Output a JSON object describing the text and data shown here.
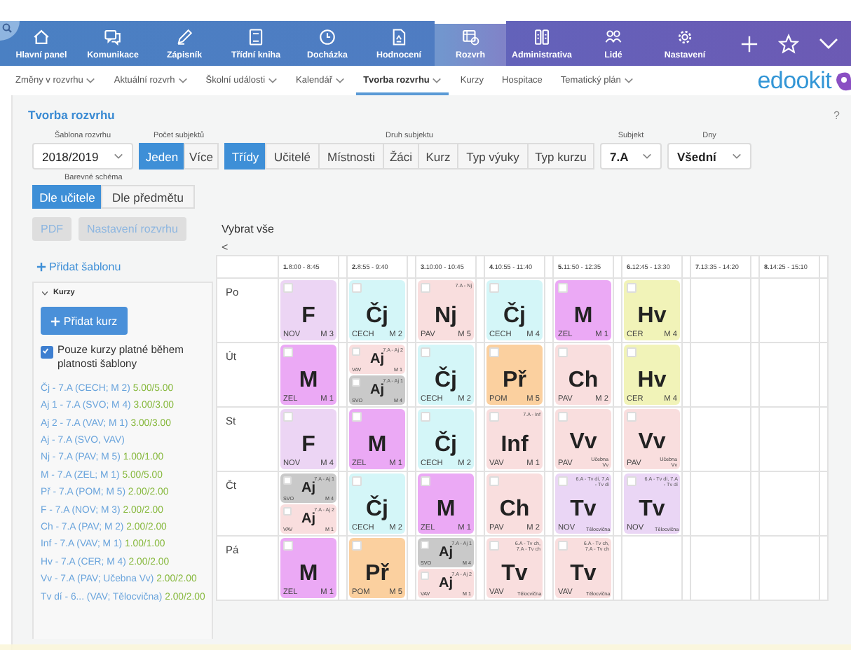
{
  "nav": {
    "items": [
      {
        "label": "Hlavní panel",
        "selected": false
      },
      {
        "label": "Komunikace",
        "selected": false
      },
      {
        "label": "Zápisník",
        "selected": false
      },
      {
        "label": "Třídní kniha",
        "selected": false
      },
      {
        "label": "Docházka",
        "selected": false
      },
      {
        "label": "Hodnocení",
        "selected": false
      },
      {
        "label": "Rozvrh",
        "selected": true
      },
      {
        "label": "Administrativa",
        "selected": false
      },
      {
        "label": "Lidé",
        "selected": false
      },
      {
        "label": "Nastavení",
        "selected": false
      }
    ]
  },
  "subnav": {
    "items": [
      {
        "label": "Změny v rozvrhu",
        "has_menu": true,
        "selected": false
      },
      {
        "label": "Aktuální rozvrh",
        "has_menu": true,
        "selected": false
      },
      {
        "label": "Školní události",
        "has_menu": true,
        "selected": false
      },
      {
        "label": "Kalendář",
        "has_menu": true,
        "selected": false
      },
      {
        "label": "Tvorba rozvrhu",
        "has_menu": true,
        "selected": true
      },
      {
        "label": "Kurzy",
        "has_menu": false,
        "selected": false
      },
      {
        "label": "Hospitace",
        "has_menu": false,
        "selected": false
      },
      {
        "label": "Tematický plán",
        "has_menu": true,
        "selected": false
      }
    ],
    "logo": "edookit"
  },
  "page": {
    "title": "Tvorba rozvrhu",
    "help": "?"
  },
  "filters": {
    "template": {
      "label": "Šablona rozvrhu",
      "value": "2018/2019"
    },
    "count": {
      "label": "Počet subjektů",
      "options": [
        {
          "label": "Jeden",
          "selected": true
        },
        {
          "label": "Více",
          "selected": false
        }
      ]
    },
    "type": {
      "label": "Druh subjektu",
      "options": [
        {
          "label": "Třídy",
          "selected": true
        },
        {
          "label": "Učitelé",
          "selected": false
        },
        {
          "label": "Místnosti",
          "selected": false
        },
        {
          "label": "Žáci",
          "selected": false
        },
        {
          "label": "Kurz",
          "selected": false
        },
        {
          "label": "Typ výuky",
          "selected": false
        },
        {
          "label": "Typ kurzu",
          "selected": false
        }
      ]
    },
    "subject": {
      "label": "Subjekt",
      "value": "7.A"
    },
    "days": {
      "label": "Dny",
      "value": "Všední"
    }
  },
  "color_scheme": {
    "label": "Barevné schéma",
    "options": [
      {
        "label": "Dle učitele",
        "selected": true
      },
      {
        "label": "Dle předmětu",
        "selected": false
      }
    ]
  },
  "actions": [
    {
      "label": "PDF",
      "disabled": true
    },
    {
      "label": "Nastavení rozvrhu",
      "disabled": true
    }
  ],
  "select_all": "Vybrat vše",
  "collapse": "<",
  "sidebar": {
    "add_template": "Přidat šablonu",
    "courses": {
      "title": "Kurzy",
      "expanded": true,
      "add": "Přidat kurz",
      "only_valid": {
        "label": "Pouze kurzy platné během platnosti šablony",
        "checked": true
      },
      "items": [
        {
          "name": "Čj - 7.A (CECH; M 2)",
          "hours": "5.00/5.00"
        },
        {
          "name": "Aj 1 - 7.A (SVO; M 4)",
          "hours": "3.00/3.00"
        },
        {
          "name": "Aj 2 - 7.A (VAV; M 1)",
          "hours": "3.00/3.00"
        },
        {
          "name": "Aj - 7.A (SVO, VAV)"
        },
        {
          "name": "Nj - 7.A (PAV; M 5)",
          "hours": "1.00/1.00"
        },
        {
          "name": "M - 7.A (ZEL; M 1)",
          "hours": "5.00/5.00"
        },
        {
          "name": "Př - 7.A (POM; M 5)",
          "hours": "2.00/2.00"
        },
        {
          "name": "F - 7.A (NOV; M 3)",
          "hours": "2.00/2.00"
        },
        {
          "name": "Ch - 7.A (PAV; M 2)",
          "hours": "2.00/2.00"
        },
        {
          "name": "Inf - 7.A (VAV; M 1)",
          "hours": "1.00/1.00"
        },
        {
          "name": "Hv - 7.A (CER; M 4)",
          "hours": "2.00/2.00"
        },
        {
          "name": "Vv - 7.A (PAV; Učebna Vv)",
          "hours": "2.00/2.00"
        },
        {
          "name": "Tv dí - 6... (VAV; Tělocvična)",
          "hours": "2.00/2.00"
        }
      ]
    }
  },
  "timetable": {
    "periods": [
      {
        "number": "1.",
        "time": "8:00 - 8:45"
      },
      {
        "number": "2.",
        "time": "8:55 - 9:40"
      },
      {
        "number": "3.",
        "time": "10:00 - 10:45"
      },
      {
        "number": "4.",
        "time": "10:55 - 11:40"
      },
      {
        "number": "5.",
        "time": "11:50 - 12:35"
      },
      {
        "number": "6.",
        "time": "12:45 - 13:30"
      },
      {
        "number": "7.",
        "time": "13:35 - 14:20"
      },
      {
        "number": "8.",
        "time": "14:25 - 15:10"
      }
    ],
    "days": [
      {
        "name": "Po",
        "slots": [
          [
            {
              "subject": "F",
              "teacher": "NOV",
              "room": "M 3",
              "color": "#ecd5f4",
              "checked": false
            }
          ],
          [
            {
              "subject": "Čj",
              "teacher": "CECH",
              "room": "M 2",
              "color": "#d4f6f8",
              "checked": false
            }
          ],
          [
            {
              "subject": "Nj",
              "teacher": "PAV",
              "room": "M 5",
              "tag": "7.A - Nj",
              "color": "#f9dede",
              "checked": false
            }
          ],
          [
            {
              "subject": "Čj",
              "teacher": "CECH",
              "room": "M 4",
              "color": "#d4f6f8",
              "checked": false
            }
          ],
          [
            {
              "subject": "M",
              "teacher": "ZEL",
              "room": "M 1",
              "color": "#eba9f5",
              "checked": false
            }
          ],
          [
            {
              "subject": "Hv",
              "teacher": "CER",
              "room": "M 4",
              "color": "#f1f3b8",
              "checked": false
            }
          ]
        ]
      },
      {
        "name": "Út",
        "slots": [
          [
            {
              "subject": "M",
              "teacher": "ZEL",
              "room": "M 1",
              "color": "#eba9f5",
              "checked": false
            }
          ],
          [
            {
              "subject": "Aj",
              "teacher": "VAV",
              "room": "M 1",
              "tag": "7.A - Aj 2",
              "color": "#f9dede",
              "checked": false
            },
            {
              "subject": "Aj",
              "teacher": "SVO",
              "room": "M 4",
              "tag": "7.A - Aj 1",
              "color": "#c9c9c9",
              "checked": false
            }
          ],
          [
            {
              "subject": "Čj",
              "teacher": "CECH",
              "room": "M 2",
              "color": "#d4f6f8",
              "checked": false
            }
          ],
          [
            {
              "subject": "Př",
              "teacher": "POM",
              "room": "M 5",
              "color": "#fbd09f",
              "checked": false
            }
          ],
          [
            {
              "subject": "Ch",
              "teacher": "PAV",
              "room": "M 2",
              "color": "#f9dede",
              "checked": false
            }
          ],
          [
            {
              "subject": "Hv",
              "teacher": "CER",
              "room": "M 4",
              "color": "#f1f3b8",
              "checked": false
            }
          ]
        ]
      },
      {
        "name": "St",
        "slots": [
          [
            {
              "subject": "F",
              "teacher": "NOV",
              "room": "M 4",
              "color": "#ecd5f4",
              "checked": false
            }
          ],
          [
            {
              "subject": "M",
              "teacher": "ZEL",
              "room": "M 1",
              "color": "#eba9f5",
              "checked": false
            }
          ],
          [
            {
              "subject": "Čj",
              "teacher": "CECH",
              "room": "M 2",
              "color": "#d4f6f8",
              "checked": false
            }
          ],
          [
            {
              "subject": "Inf",
              "teacher": "VAV",
              "room": "M 1",
              "tag": "7.A - Inf",
              "color": "#f9dede",
              "checked": false
            }
          ],
          [
            {
              "subject": "Vv",
              "teacher": "PAV",
              "room": "Učebna Vv",
              "color": "#f9dede",
              "checked": false
            }
          ],
          [
            {
              "subject": "Vv",
              "teacher": "PAV",
              "room": "Učebna Vv",
              "color": "#f9dede",
              "checked": false
            }
          ]
        ]
      },
      {
        "name": "Čt",
        "slots": [
          [
            {
              "subject": "Aj",
              "teacher": "SVO",
              "room": "M 4",
              "tag": "7.A - Aj 1",
              "color": "#c9c9c9",
              "checked": false
            },
            {
              "subject": "Aj",
              "teacher": "VAV",
              "room": "M 1",
              "tag": "7.A - Aj 2",
              "color": "#f9dede",
              "checked": false
            }
          ],
          [
            {
              "subject": "Čj",
              "teacher": "CECH",
              "room": "M 2",
              "color": "#d4f6f8",
              "checked": false
            }
          ],
          [
            {
              "subject": "M",
              "teacher": "ZEL",
              "room": "M 1",
              "color": "#eba9f5",
              "checked": false
            }
          ],
          [
            {
              "subject": "Ch",
              "teacher": "PAV",
              "room": "M 2",
              "color": "#f9dede",
              "checked": false
            }
          ],
          [
            {
              "subject": "Tv",
              "teacher": "NOV",
              "room": "Tělocvična",
              "tag": "6.A - Tv dí, 7.A - Tv dí",
              "color": "#ead6f5",
              "checked": false
            }
          ],
          [
            {
              "subject": "Tv",
              "teacher": "NOV",
              "room": "Tělocvična",
              "tag": "6.A - Tv dí, 7.A - Tv dí",
              "color": "#ead6f5",
              "checked": false
            }
          ]
        ]
      },
      {
        "name": "Pá",
        "slots": [
          [
            {
              "subject": "M",
              "teacher": "ZEL",
              "room": "M 1",
              "color": "#eba9f5",
              "checked": false
            }
          ],
          [
            {
              "subject": "Př",
              "teacher": "POM",
              "room": "M 5",
              "color": "#fbd09f",
              "checked": false
            }
          ],
          [
            {
              "subject": "Aj",
              "teacher": "SVO",
              "room": "M 4",
              "tag": "7.A - Aj 1",
              "color": "#c9c9c9",
              "checked": false
            },
            {
              "subject": "Aj",
              "teacher": "VAV",
              "room": "M 1",
              "tag": "7.A - Aj 2",
              "color": "#f9dede",
              "checked": false
            }
          ],
          [
            {
              "subject": "Tv",
              "teacher": "VAV",
              "room": "Tělocvična",
              "tag": "6.A - Tv ch, 7.A - Tv ch",
              "color": "#f9dede",
              "checked": false
            }
          ],
          [
            {
              "subject": "Tv",
              "teacher": "VAV",
              "room": "Tělocvična",
              "tag": "6.A - Tv ch, 7.A - Tv ch",
              "color": "#f9dede",
              "checked": false
            }
          ]
        ]
      }
    ]
  }
}
